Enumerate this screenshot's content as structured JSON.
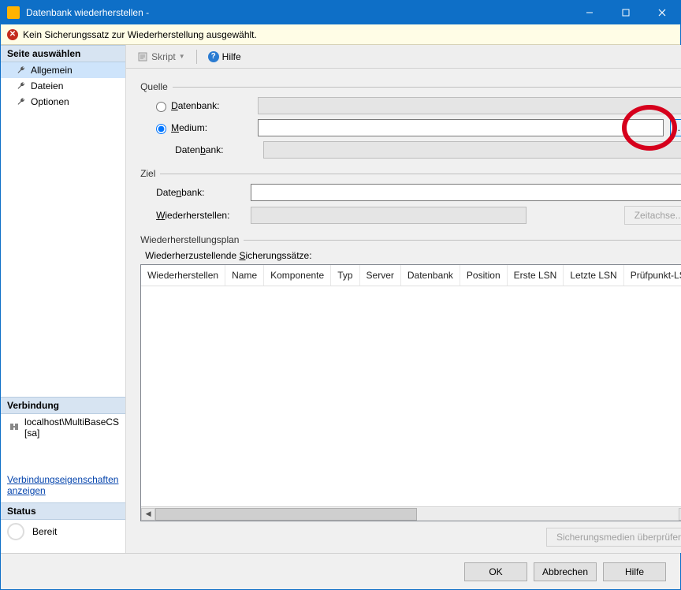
{
  "window": {
    "title": "Datenbank wiederherstellen -"
  },
  "warning": {
    "text": "Kein Sicherungssatz zur Wiederherstellung ausgewählt."
  },
  "sidebar": {
    "sections": {
      "pages_header": "Seite auswählen",
      "pages": [
        {
          "label": "Allgemein",
          "selected": true
        },
        {
          "label": "Dateien",
          "selected": false
        },
        {
          "label": "Optionen",
          "selected": false
        }
      ],
      "connection_header": "Verbindung",
      "connection_value": "localhost\\MultiBaseCS [sa]",
      "connection_link": "Verbindungseigenschaften anzeigen",
      "status_header": "Status",
      "status_value": "Bereit"
    }
  },
  "toolbar": {
    "script": "Skript",
    "help": "Hilfe"
  },
  "source": {
    "section": "Quelle",
    "radio_database": "Datenbank:",
    "radio_medium": "Medium:",
    "sub_database": "Datenbank:",
    "browse": "..."
  },
  "target": {
    "section": "Ziel",
    "database": "Datenbank:",
    "restore_to": "Wiederherstellen:",
    "timeline_btn": "Zeitachse..."
  },
  "plan": {
    "section": "Wiederherstellungsplan",
    "subtitle": "Wiederherzustellende Sicherungssätze:",
    "columns": [
      "Wiederherstellen",
      "Name",
      "Komponente",
      "Typ",
      "Server",
      "Datenbank",
      "Position",
      "Erste LSN",
      "Letzte LSN",
      "Prüfpunkt-LS"
    ],
    "verify_btn": "Sicherungsmedien überprüfen"
  },
  "footer": {
    "ok": "OK",
    "cancel": "Abbrechen",
    "help": "Hilfe"
  }
}
